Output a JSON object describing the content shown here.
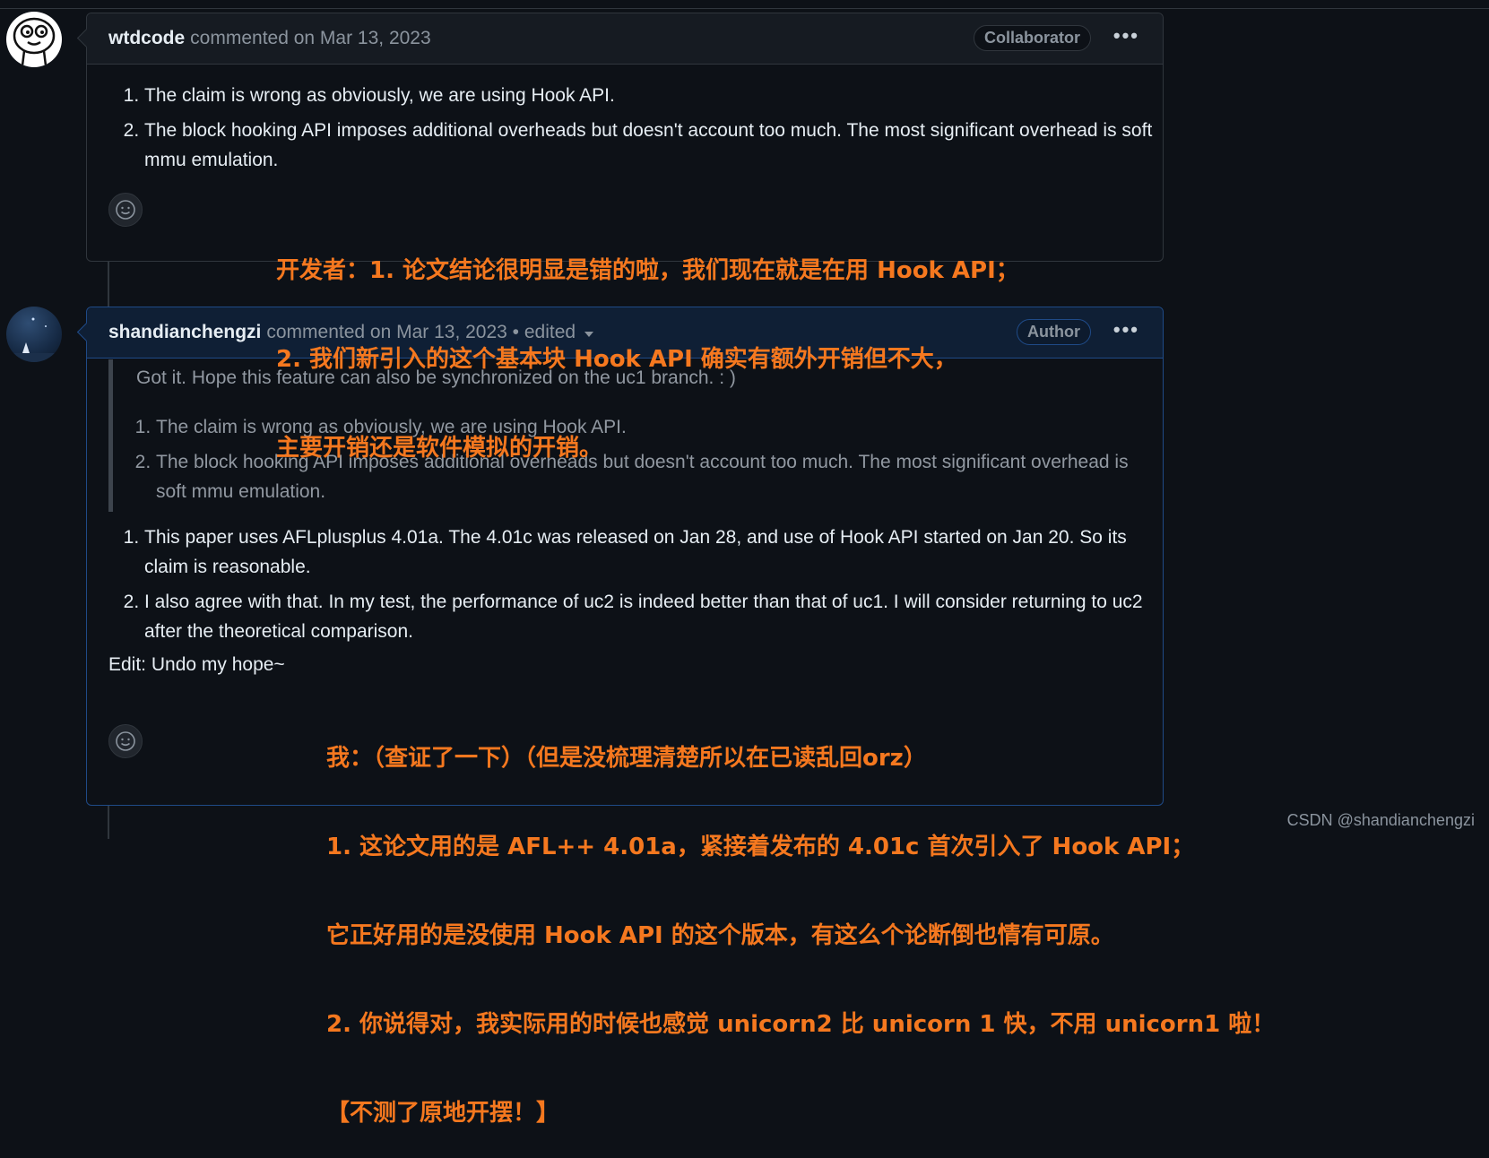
{
  "comments": [
    {
      "author": "wtdcode",
      "meta": "commented on Mar 13, 2023",
      "badge": "Collaborator",
      "items": [
        "The claim is wrong as obviously, we are using Hook API.",
        "The block hooking API imposes additional overheads but doesn't account too much. The most significant overhead is soft mmu emulation."
      ]
    },
    {
      "author": "shandianchengzi",
      "meta": "commented on Mar 13, 2023 • edited",
      "badge": "Author",
      "quote": {
        "text": "Got it. Hope this feature can also be synchronized on the uc1 branch. : )",
        "items": [
          "The claim is wrong as obviously, we are using Hook API.",
          "The block hooking API imposes additional overheads but doesn't account too much. The most significant overhead is soft mmu emulation."
        ]
      },
      "items": [
        "This paper uses AFLplusplus 4.01a. The 4.01c was released on Jan 28, and use of Hook API started on Jan 20. So its claim is reasonable.",
        "I also agree with that. In my test, the performance of uc2 is indeed better than that of uc1. I will consider returning to uc2 after the theoretical comparison."
      ],
      "edit": "Edit: Undo my hope~"
    }
  ],
  "annotations": {
    "dev": [
      "开发者：1. 论文结论很明显是错的啦，我们现在就是在用 Hook API；",
      "2. 我们新引入的这个基本块 Hook API 确实有额外开销但不大，",
      "主要开销还是软件模拟的开销。"
    ],
    "me": [
      "我：（查证了一下）（但是没梳理清楚所以在已读乱回orz）",
      "1. 这论文用的是 AFL++ 4.01a，紧接着发布的 4.01c 首次引入了 Hook API；",
      "它正好用的是没使用 Hook API 的这个版本，有这么个论断倒也情有可原。",
      "2. 你说得对，我实际用的时候也感觉 unicorn2 比 unicorn 1 快，不用 unicorn1 啦！",
      "【不测了原地开摆！】"
    ]
  },
  "watermark": "CSDN @shandianchengzi",
  "colors": {
    "background": "#0d1117",
    "annotation": "#f5781f",
    "border": "#30363d",
    "author_border": "#1f4a87"
  },
  "icons": [
    "smiley-icon",
    "kebab-menu-icon",
    "caret-down-icon"
  ]
}
